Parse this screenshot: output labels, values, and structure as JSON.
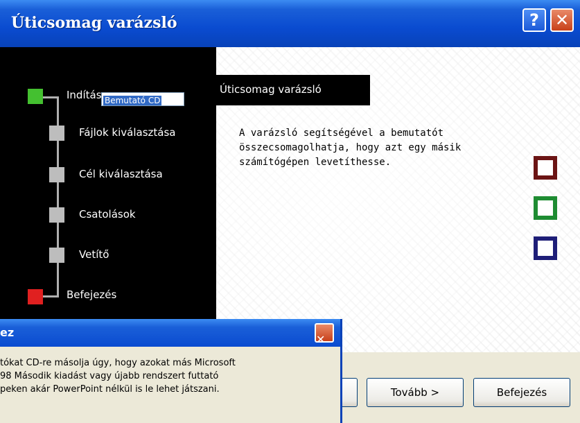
{
  "window": {
    "title": "Úticsomag varázsló",
    "help_glyph": "?",
    "close_glyph": "✕"
  },
  "steps": [
    {
      "label": "Indítás",
      "state": "current",
      "color": "#44c030"
    },
    {
      "label": "Fájlok kiválasztása",
      "state": "pending",
      "color": "#bdbdbd"
    },
    {
      "label": "Cél kiválasztása",
      "state": "pending",
      "color": "#bdbdbd"
    },
    {
      "label": "Csatolások",
      "state": "pending",
      "color": "#bdbdbd"
    },
    {
      "label": "Vetítő",
      "state": "pending",
      "color": "#bdbdbd"
    },
    {
      "label": "Befejezés",
      "state": "end",
      "color": "#e02020"
    }
  ],
  "content": {
    "header": "Úticsomag varázsló",
    "description": "A varázsló segítségével a bemutatót összecsomagolhatja, hogy azt egy másik számítógépen levetíthesse.",
    "decor_colors": [
      "#6b1414",
      "#1e8c32",
      "#1e1e78"
    ]
  },
  "buttons": {
    "back": "",
    "next": "Tovább >",
    "finish": "Befejezés"
  },
  "dialog": {
    "title": "ez",
    "close_glyph": "✕",
    "text_line1": "tókat CD-re másolja úgy, hogy azokat más Microsoft",
    "text_line2": "98 Második kiadást vagy újabb rendszert futtató",
    "text_line3": "peken akár PowerPoint nélkül is le lehet játszani.",
    "input_value": "Bemutató CD"
  }
}
